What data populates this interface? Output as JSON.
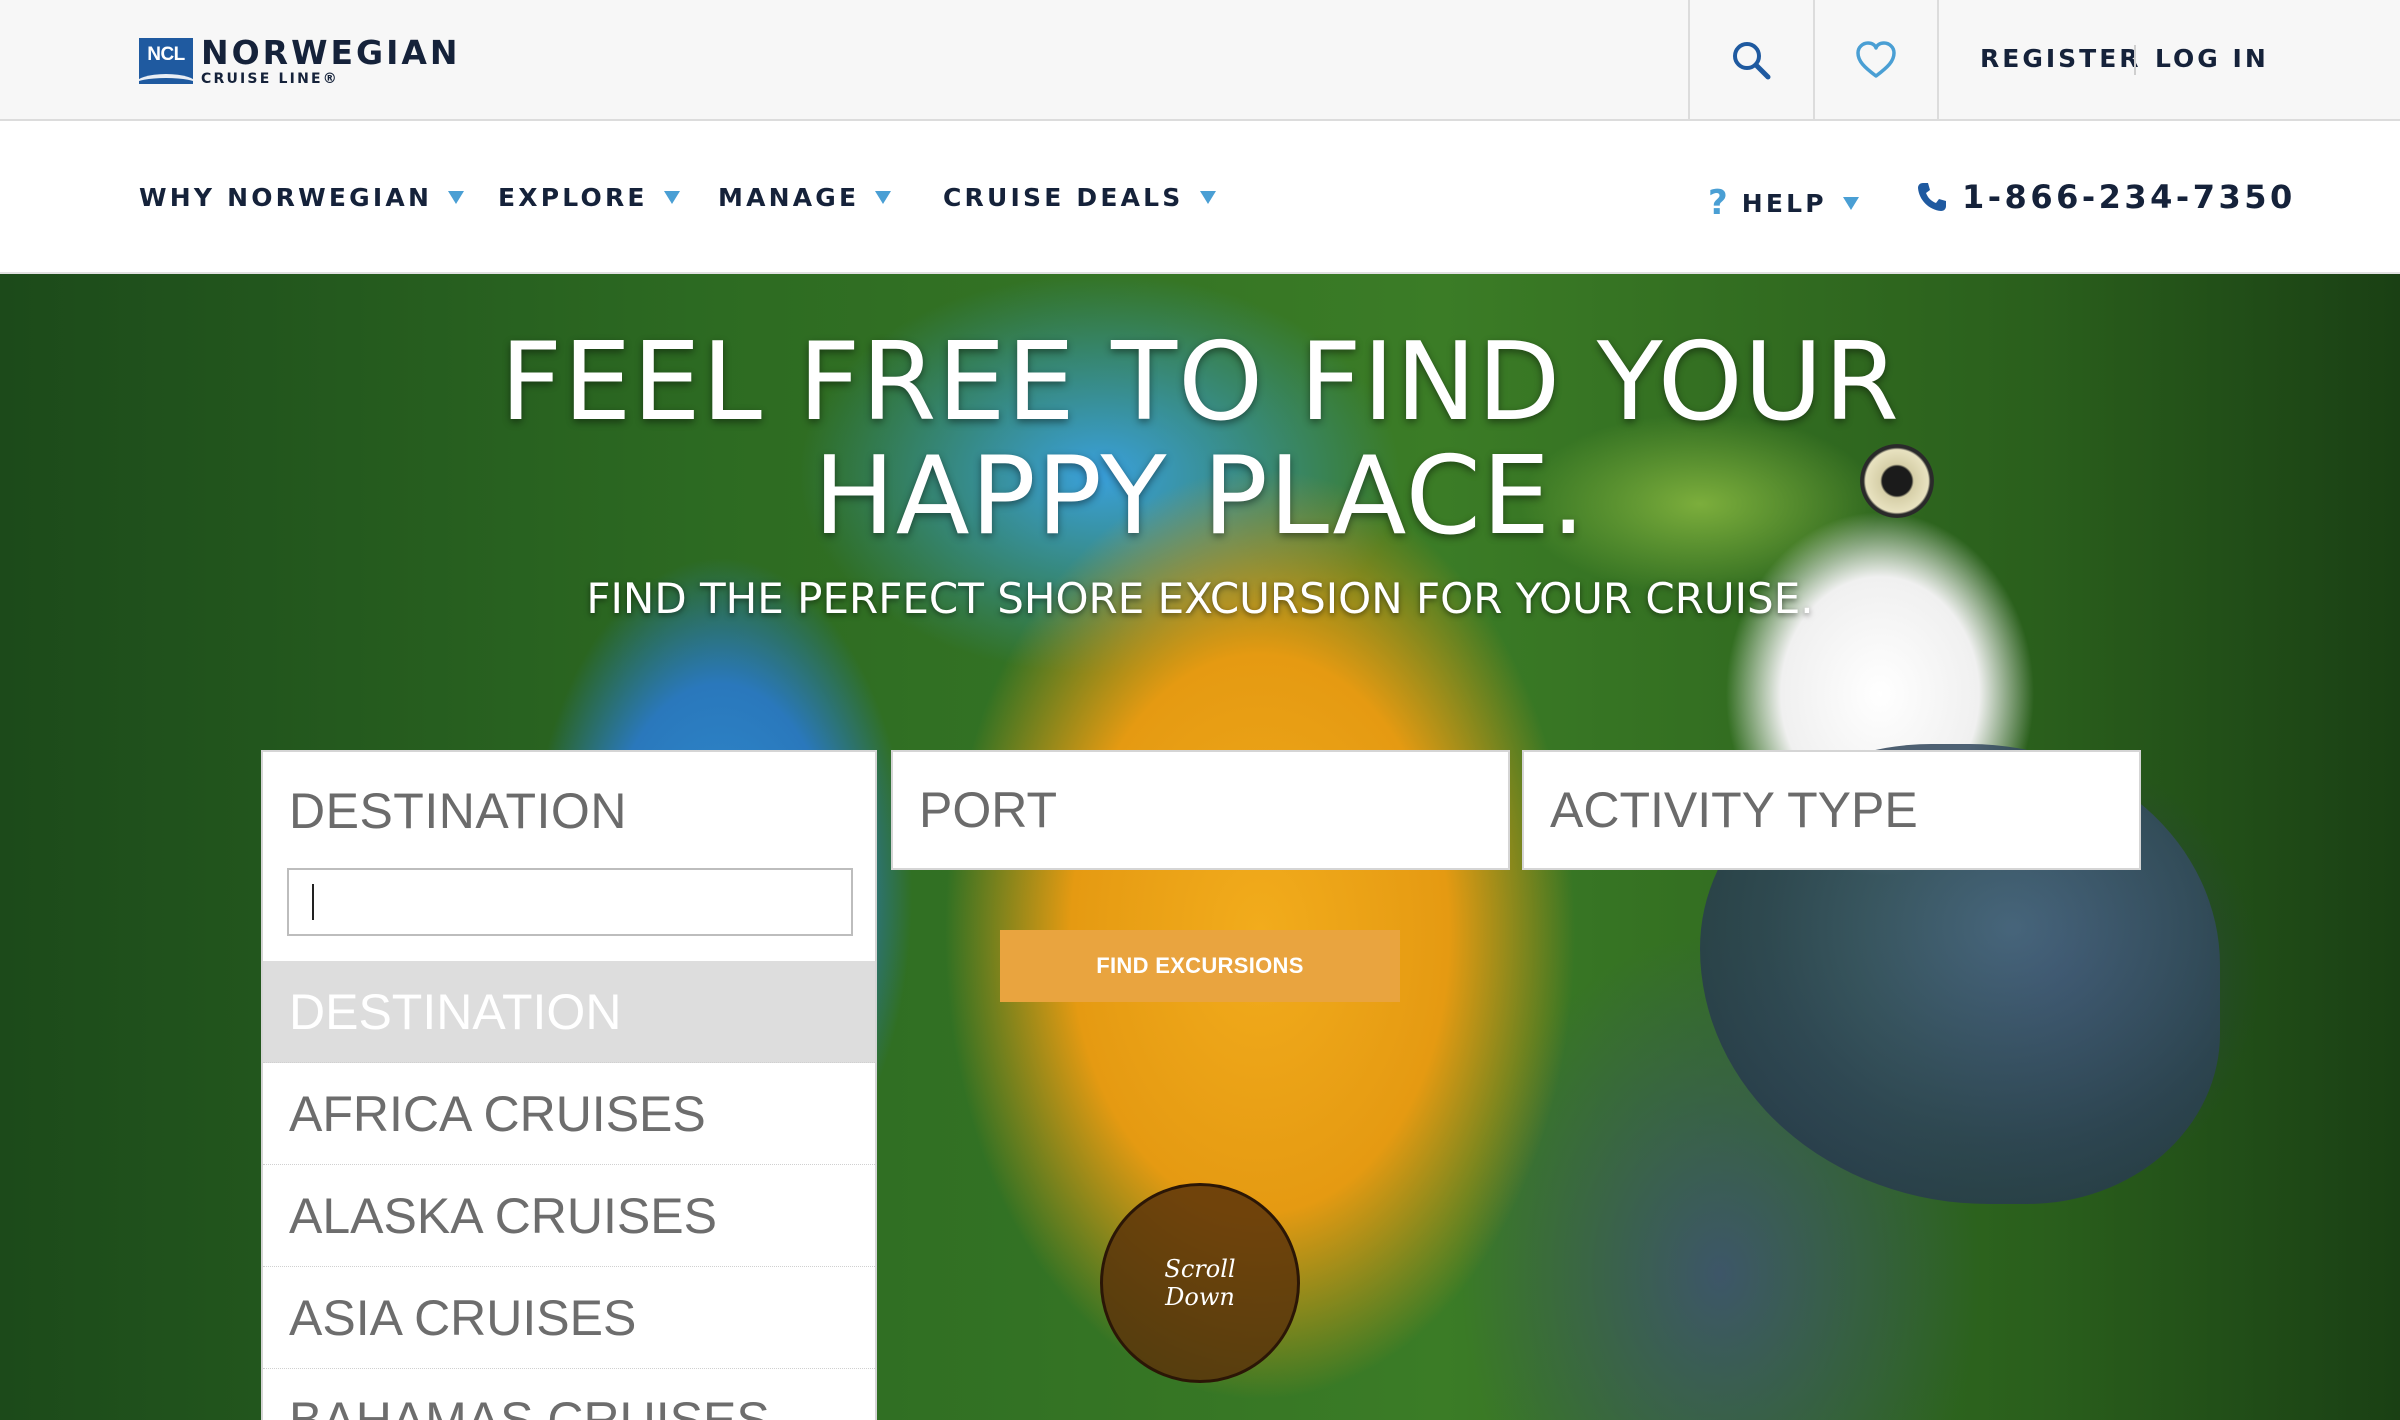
{
  "brand": {
    "badge": "NCL",
    "name": "NORWEGIAN",
    "subline": "CRUISE LINE®"
  },
  "utility": {
    "register": "REGISTER",
    "login": "LOG IN"
  },
  "nav": {
    "items": [
      {
        "label": "WHY NORWEGIAN"
      },
      {
        "label": "EXPLORE"
      },
      {
        "label": "MANAGE"
      },
      {
        "label": "CRUISE DEALS"
      }
    ],
    "help": "HELP",
    "help_icon": "?",
    "phone": "1-866-234-7350"
  },
  "hero": {
    "title_line1": "FEEL FREE TO FIND YOUR",
    "title_line2": "HAPPY PLACE.",
    "subtitle": "FIND THE PERFECT SHORE EXCURSION FOR YOUR CRUISE."
  },
  "search": {
    "destination_label": "DESTINATION",
    "destination_search_value": "",
    "destination_options": [
      {
        "label": "DESTINATION",
        "selected": true
      },
      {
        "label": "AFRICA CRUISES",
        "selected": false
      },
      {
        "label": "ALASKA CRUISES",
        "selected": false
      },
      {
        "label": "ASIA CRUISES",
        "selected": false
      },
      {
        "label": "BAHAMAS CRUISES",
        "selected": false
      }
    ],
    "port_label": "PORT",
    "activity_label": "ACTIVITY TYPE",
    "submit_label": "FIND EXCURSIONS"
  },
  "scroll": {
    "line1": "Scroll",
    "line2": "Down"
  },
  "colors": {
    "navy": "#15223a",
    "accent_blue": "#4a9fd4",
    "button_orange": "#e9a43f",
    "brand_blue": "#1f5aa0"
  },
  "icons": {
    "search": "search-icon",
    "heart": "heart-icon",
    "phone": "phone-icon",
    "help": "question-icon",
    "caret": "caret-down-icon"
  }
}
